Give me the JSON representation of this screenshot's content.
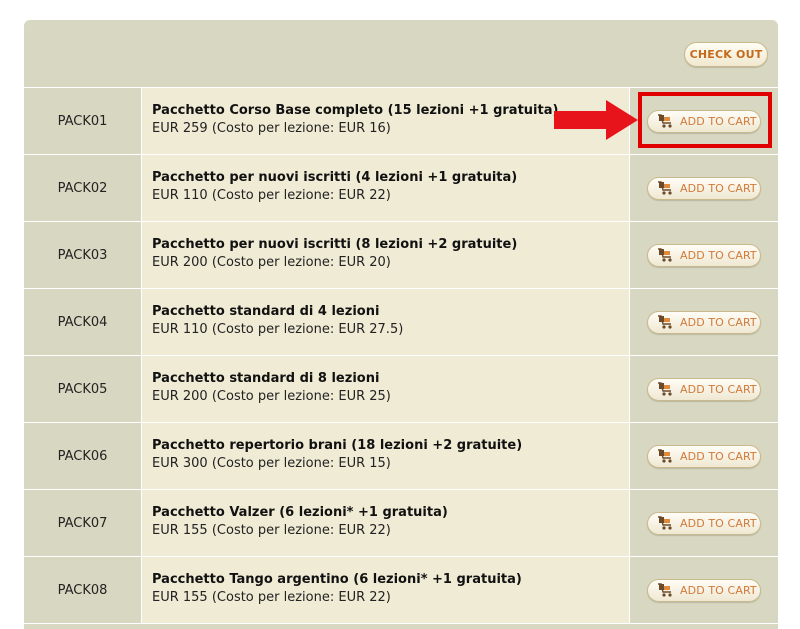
{
  "header": {
    "checkout_label": "CHECK OUT"
  },
  "add_to_cart_label": "ADD TO CART",
  "packages": [
    {
      "code": "PACK01",
      "title": "Pacchetto Corso Base completo (15 lezioni +1 gratuita)",
      "price": "EUR 259 (Costo per lezione: EUR 16)"
    },
    {
      "code": "PACK02",
      "title": "Pacchetto per nuovi iscritti (4 lezioni +1 gratuita)",
      "price": "EUR 110 (Costo per lezione: EUR 22)"
    },
    {
      "code": "PACK03",
      "title": "Pacchetto per nuovi iscritti (8 lezioni +2 gratuite)",
      "price": "EUR 200 (Costo per lezione: EUR 20)"
    },
    {
      "code": "PACK04",
      "title": "Pacchetto standard di 4 lezioni",
      "price": "EUR 110 (Costo per lezione: EUR 27.5)"
    },
    {
      "code": "PACK05",
      "title": "Pacchetto standard di 8 lezioni",
      "price": "EUR 200 (Costo per lezione: EUR 25)"
    },
    {
      "code": "PACK06",
      "title": "Pacchetto repertorio brani (18 lezioni +2 gratuite)",
      "price": "EUR 300 (Costo per lezione: EUR 15)"
    },
    {
      "code": "PACK07",
      "title": "Pacchetto Valzer (6 lezioni* +1 gratuita)",
      "price": "EUR 155 (Costo per lezione: EUR 22)"
    },
    {
      "code": "PACK08",
      "title": "Pacchetto Tango argentino (6 lezioni* +1 gratuita)",
      "price": "EUR 155 (Costo per lezione: EUR 22)"
    }
  ],
  "colors": {
    "panel": "#d8d8c2",
    "description_cell": "#f0ebd5",
    "button_text": "#d07a3a",
    "highlight": "#e00000"
  },
  "annotation": {
    "icon": "arrow-right-icon",
    "target": "PACK01 add-to-cart button"
  }
}
